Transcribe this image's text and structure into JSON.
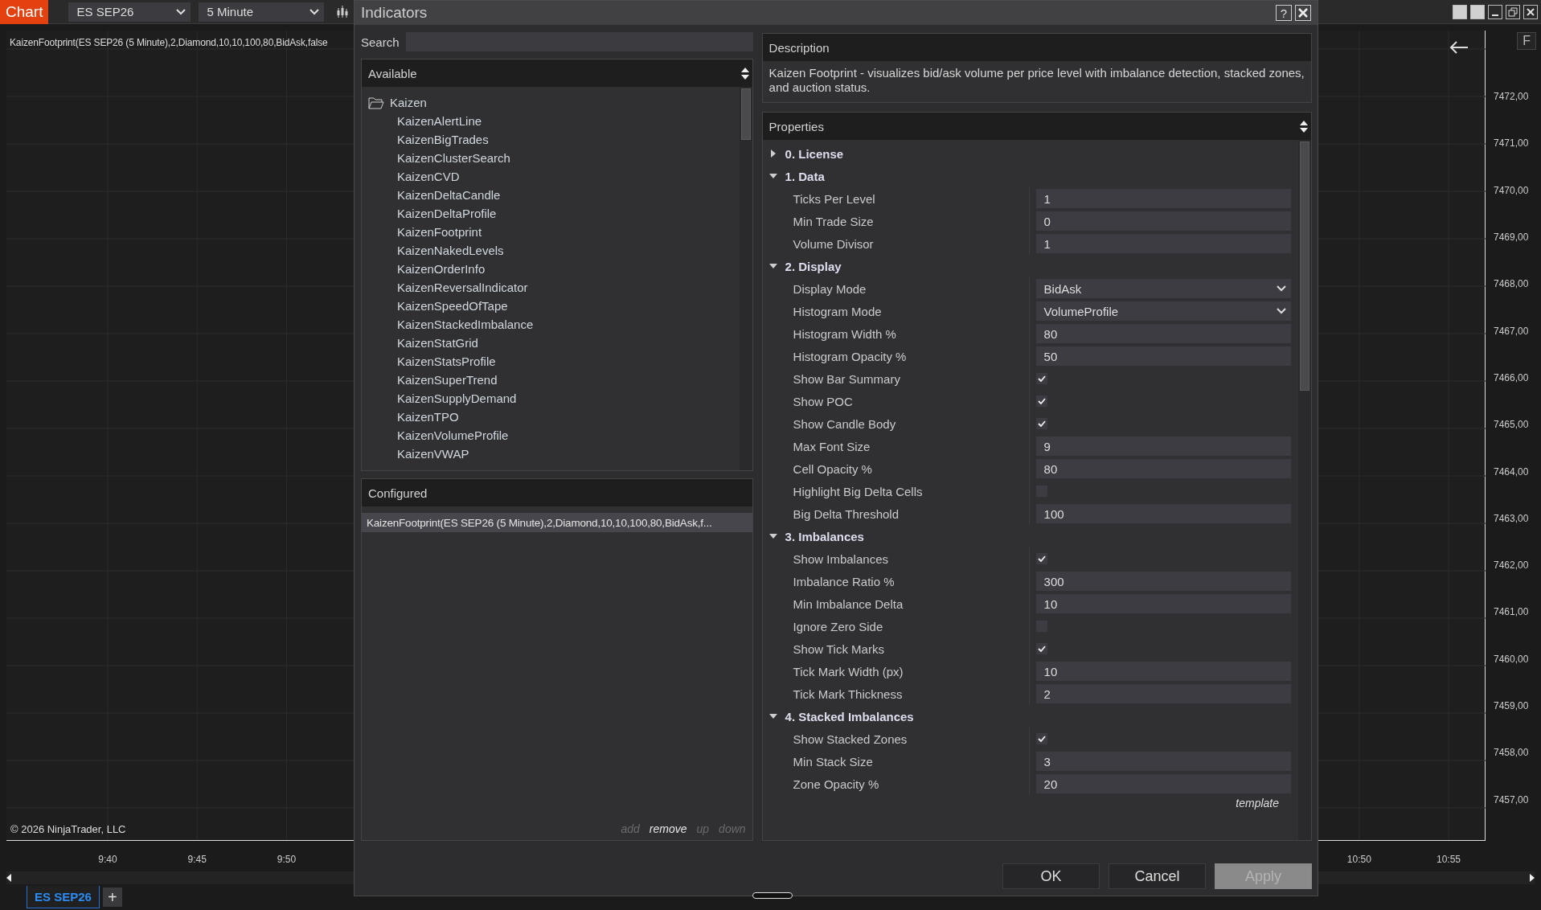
{
  "top_bar": {
    "app_label": "Chart",
    "instrument": "ES SEP26",
    "interval": "5 Minute"
  },
  "chart": {
    "indicator_label": "KaizenFootprint(ES SEP26 (5 Minute),2,Diamond,10,10,100,80,BidAsk,false",
    "copyright": "© 2026 NinjaTrader, LLC",
    "f_button": "F",
    "price_axis": [
      "7472,00",
      "7471,00",
      "7470,00",
      "7469,00",
      "7468,00",
      "7467,00",
      "7466,00",
      "7465,00",
      "7464,00",
      "7463,00",
      "7462,00",
      "7461,00",
      "7460,00",
      "7459,00",
      "7458,00",
      "7457,00"
    ],
    "time_axis": [
      "9:40",
      "9:45",
      "9:50",
      "10:50",
      "10:55"
    ],
    "tabs": [
      {
        "label": "ES SEP26",
        "selected": true
      }
    ],
    "add_tab": "+"
  },
  "dialog": {
    "title": "Indicators",
    "help": "?",
    "search": {
      "label": "Search"
    },
    "available": {
      "title": "Available",
      "folder": {
        "label": "Kaizen",
        "expanded": true,
        "children": [
          {
            "label": "KaizenAlertLine"
          },
          {
            "label": "KaizenBigTrades"
          },
          {
            "label": "KaizenClusterSearch"
          },
          {
            "label": "KaizenCVD"
          },
          {
            "label": "KaizenDeltaCandle"
          },
          {
            "label": "KaizenDeltaProfile"
          },
          {
            "label": "KaizenFootprint"
          },
          {
            "label": "KaizenNakedLevels"
          },
          {
            "label": "KaizenOrderInfo"
          },
          {
            "label": "KaizenReversalIndicator"
          },
          {
            "label": "KaizenSpeedOfTape"
          },
          {
            "label": "KaizenStackedImbalance"
          },
          {
            "label": "KaizenStatGrid"
          },
          {
            "label": "KaizenStatsProfile"
          },
          {
            "label": "KaizenSuperTrend"
          },
          {
            "label": "KaizenSupplyDemand"
          },
          {
            "label": "KaizenTPO"
          },
          {
            "label": "KaizenVolumeProfile"
          },
          {
            "label": "KaizenVWAP"
          }
        ]
      }
    },
    "configured": {
      "title": "Configured",
      "items": [
        {
          "label": "KaizenFootprint(ES SEP26 (5 Minute),2,Diamond,10,10,100,80,BidAsk,f...",
          "selected": true
        }
      ],
      "actions": [
        {
          "label": "add",
          "disabled": true
        },
        {
          "label": "remove",
          "disabled": false
        },
        {
          "label": "up",
          "disabled": true
        },
        {
          "label": "down",
          "disabled": true
        }
      ]
    },
    "description": {
      "title": "Description",
      "text": "Kaizen Footprint - visualizes bid/ask volume per price level with imbalance detection, stacked zones, and auction status."
    },
    "properties": {
      "title": "Properties",
      "template": "template",
      "groups": [
        {
          "label": "0. License",
          "expanded": false
        },
        {
          "label": "1. Data",
          "expanded": true,
          "rows": [
            {
              "label": "Ticks Per Level",
              "kind": "text",
              "value": "1"
            },
            {
              "label": "Min Trade Size",
              "kind": "text",
              "value": "0"
            },
            {
              "label": "Volume Divisor",
              "kind": "text",
              "value": "1"
            }
          ]
        },
        {
          "label": "2. Display",
          "expanded": true,
          "rows": [
            {
              "label": "Display Mode",
              "kind": "dropdown",
              "value": "BidAsk"
            },
            {
              "label": "Histogram Mode",
              "kind": "dropdown",
              "value": "VolumeProfile"
            },
            {
              "label": "Histogram Width %",
              "kind": "text",
              "value": "80"
            },
            {
              "label": "Histogram Opacity %",
              "kind": "text",
              "value": "50"
            },
            {
              "label": "Show Bar Summary",
              "kind": "checkbox",
              "checked": true
            },
            {
              "label": "Show POC",
              "kind": "checkbox",
              "checked": true
            },
            {
              "label": "Show Candle Body",
              "kind": "checkbox",
              "checked": true
            },
            {
              "label": "Max Font Size",
              "kind": "text",
              "value": "9"
            },
            {
              "label": "Cell Opacity %",
              "kind": "text",
              "value": "80"
            },
            {
              "label": "Highlight Big Delta Cells",
              "kind": "checkbox",
              "checked": false
            },
            {
              "label": "Big Delta Threshold",
              "kind": "text",
              "value": "100"
            }
          ]
        },
        {
          "label": "3. Imbalances",
          "expanded": true,
          "rows": [
            {
              "label": "Show Imbalances",
              "kind": "checkbox",
              "checked": true
            },
            {
              "label": "Imbalance Ratio %",
              "kind": "text",
              "value": "300"
            },
            {
              "label": "Min Imbalance Delta",
              "kind": "text",
              "value": "10"
            },
            {
              "label": "Ignore Zero Side",
              "kind": "checkbox",
              "checked": false
            },
            {
              "label": "Show Tick Marks",
              "kind": "checkbox",
              "checked": true
            },
            {
              "label": "Tick Mark Width (px)",
              "kind": "text",
              "value": "10"
            },
            {
              "label": "Tick Mark Thickness",
              "kind": "text",
              "value": "2"
            }
          ]
        },
        {
          "label": "4. Stacked Imbalances",
          "expanded": true,
          "rows": [
            {
              "label": "Show Stacked Zones",
              "kind": "checkbox",
              "checked": true
            },
            {
              "label": "Min Stack Size",
              "kind": "text",
              "value": "3"
            },
            {
              "label": "Zone Opacity %",
              "kind": "text",
              "value": "20"
            }
          ]
        }
      ]
    },
    "buttons": [
      {
        "label": "OK",
        "disabled": false
      },
      {
        "label": "Cancel",
        "disabled": false
      },
      {
        "label": "Apply",
        "disabled": true
      }
    ]
  }
}
